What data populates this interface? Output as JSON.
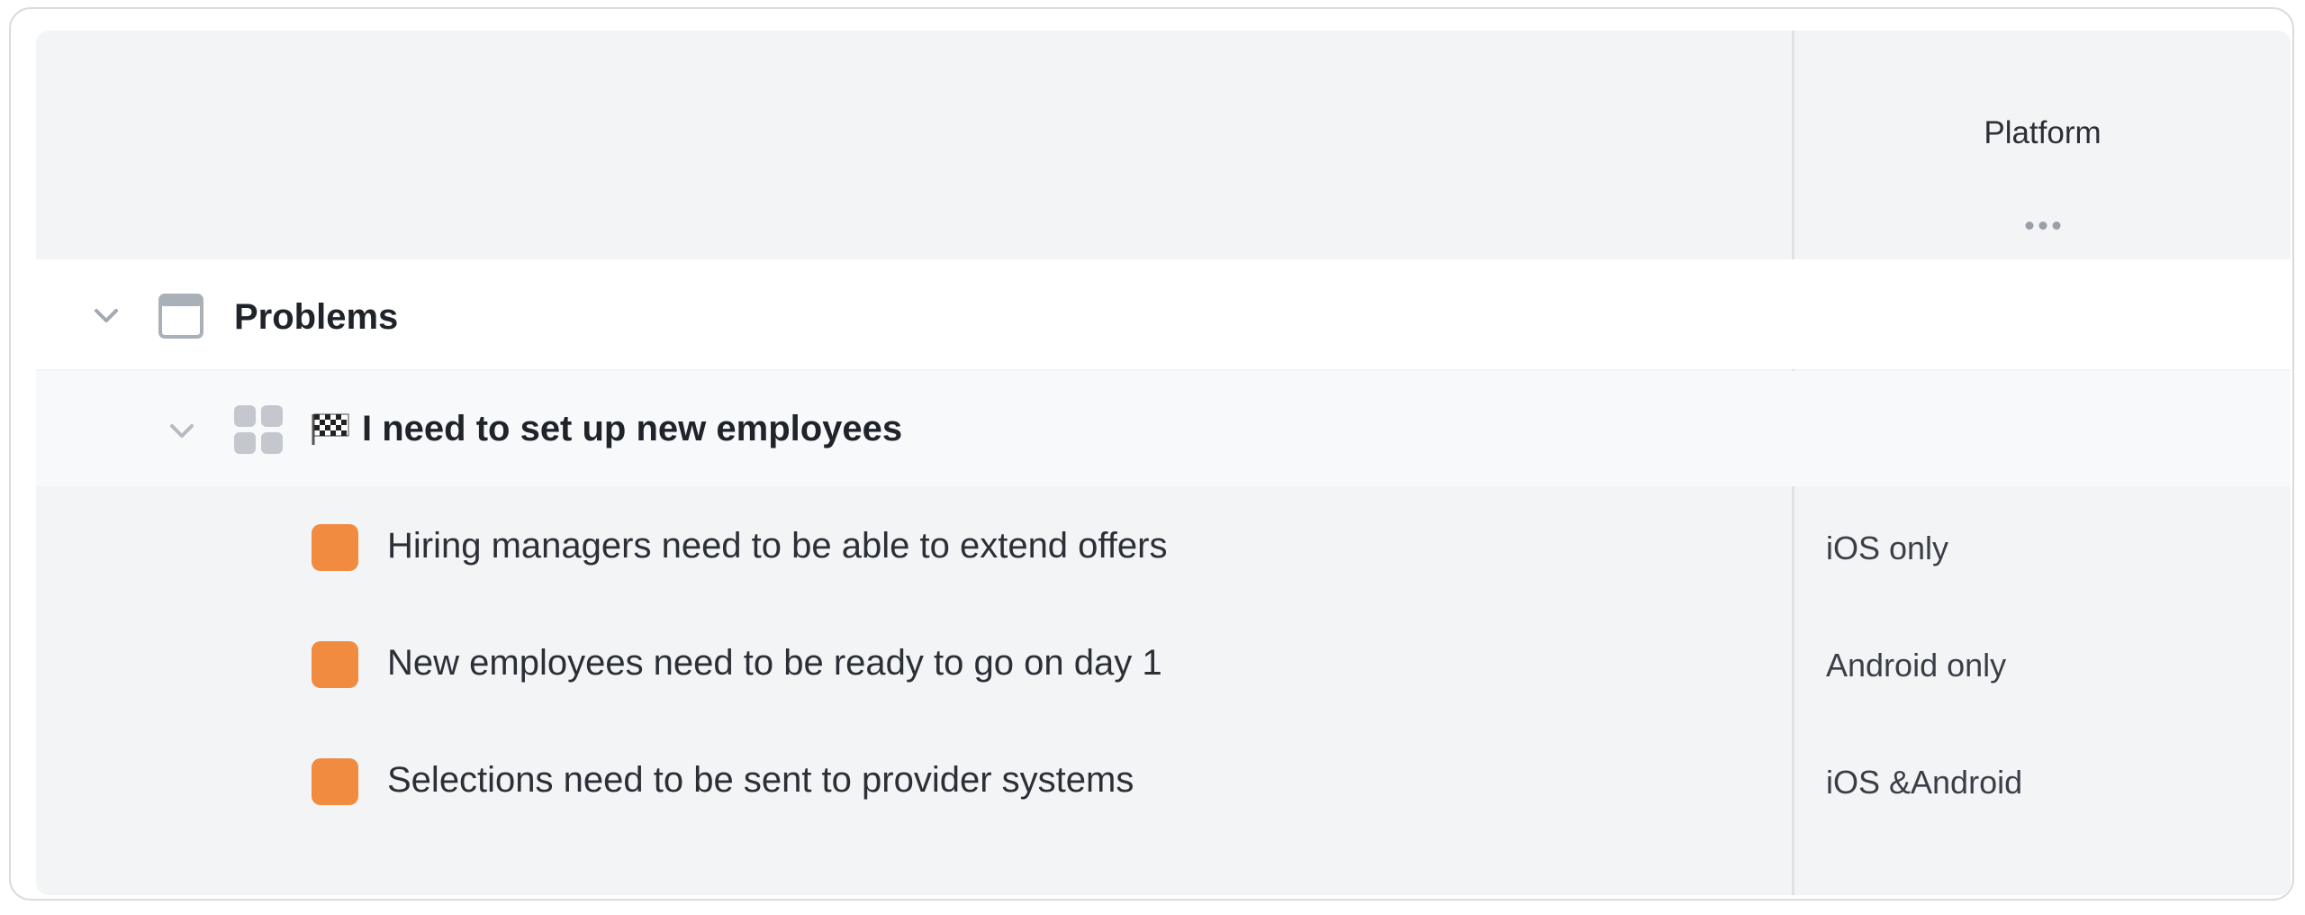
{
  "column": {
    "title": "Platform",
    "menu_icon": "more-horizontal-icon"
  },
  "group": {
    "label": "Problems",
    "icon": "window-icon",
    "expanded": true
  },
  "subgroup": {
    "emoji": "🏁",
    "label": "I need to set up new employees",
    "icon": "grid-icon",
    "expanded": true
  },
  "items": [
    {
      "label": "Hiring managers need to be able to extend offers",
      "platform": "iOS only",
      "color": "#f18b40"
    },
    {
      "label": "New employees need to be ready to go on day 1",
      "platform": "Android only",
      "color": "#f18b40"
    },
    {
      "label": "Selections need to be sent to provider systems",
      "platform": "iOS &Android",
      "color": "#f18b40"
    }
  ]
}
